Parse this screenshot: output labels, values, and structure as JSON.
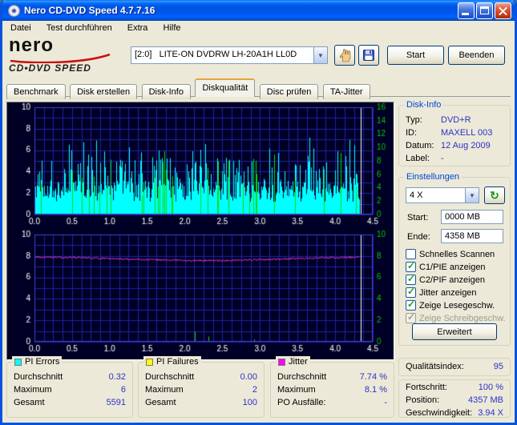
{
  "window": {
    "title": "Nero CD-DVD Speed 4.7.7.16"
  },
  "menu": {
    "items": [
      {
        "label": "Datei"
      },
      {
        "label": "Test durchführen"
      },
      {
        "label": "Extra"
      },
      {
        "label": "Hilfe"
      }
    ]
  },
  "logo": {
    "brand": "nero",
    "product": "CD•DVD SPEED"
  },
  "toolbar": {
    "drive_combo_value": "[2:0]   LITE-ON DVDRW LH-20A1H LL0D",
    "start_label": "Start",
    "quit_label": "Beenden"
  },
  "tabs": {
    "items": [
      {
        "label": "Benchmark"
      },
      {
        "label": "Disk erstellen"
      },
      {
        "label": "Disk-Info"
      },
      {
        "label": "Diskqualität"
      },
      {
        "label": "Disc prüfen"
      },
      {
        "label": "TA-Jitter"
      }
    ]
  },
  "disk_info": {
    "title": "Disk-Info",
    "rows": [
      {
        "label": "Typ:",
        "value": "DVD+R"
      },
      {
        "label": "ID:",
        "value": "MAXELL 003"
      },
      {
        "label": "Datum:",
        "value": "12 Aug 2009"
      },
      {
        "label": "Label:",
        "value": "-"
      }
    ]
  },
  "settings": {
    "title": "Einstellungen",
    "speed_combo_value": "4 X",
    "start_label": "Start:",
    "start_value": "0000 MB",
    "end_label": "Ende:",
    "end_value": "4358 MB",
    "checkboxes": [
      {
        "label": "Schnelles Scannen",
        "checked": false
      },
      {
        "label": "C1/PIE anzeigen",
        "checked": true
      },
      {
        "label": "C2/PIF anzeigen",
        "checked": true
      },
      {
        "label": "Jitter anzeigen",
        "checked": true
      },
      {
        "label": "Zeige Lesegeschw.",
        "checked": true
      },
      {
        "label": "Zeige Schreibgeschw.",
        "checked": true,
        "disabled": true
      }
    ],
    "advanced_label": "Erweitert"
  },
  "quality": {
    "label": "Qualitätsindex:",
    "value": "95"
  },
  "progress": {
    "rows": [
      {
        "label": "Fortschritt:",
        "value": "100 %"
      },
      {
        "label": "Position:",
        "value": "4357 MB"
      },
      {
        "label": "Geschwindigkeit:",
        "value": "3.94 X"
      }
    ]
  },
  "stats": {
    "pi_errors": {
      "title": "PI Errors",
      "color": "#00FFFF",
      "rows": [
        {
          "label": "Durchschnitt",
          "value": "0.32"
        },
        {
          "label": "Maximum",
          "value": "6"
        },
        {
          "label": "Gesamt",
          "value": "5591"
        }
      ]
    },
    "pi_failures": {
      "title": "PI Failures",
      "color": "#FFFF00",
      "rows": [
        {
          "label": "Durchschnitt",
          "value": "0.00"
        },
        {
          "label": "Maximum",
          "value": "2"
        },
        {
          "label": "Gesamt",
          "value": "100"
        }
      ]
    },
    "jitter": {
      "title": "Jitter",
      "color": "#FF00FF",
      "rows": [
        {
          "label": "Durchschnitt",
          "value": "7.74 %"
        },
        {
          "label": "Maximum",
          "value": "8.1 %"
        },
        {
          "label": "PO Ausfälle:",
          "value": "-"
        }
      ]
    }
  },
  "chart_data": {
    "type": "line",
    "x_range": [
      0,
      4.5
    ],
    "x_ticks": [
      "0.0",
      "0.5",
      "1.0",
      "1.5",
      "2.0",
      "2.5",
      "3.0",
      "3.5",
      "4.0",
      "4.5"
    ],
    "end_position_x": 4.34,
    "colors": {
      "background": "#000026",
      "grid": "#2121A6",
      "border": "#4242C8",
      "axis_left": "#FFFFFF",
      "axis_right": "#00C800",
      "pie": "#00FFFF",
      "pif_spikes": "#00E000",
      "jitter": "#FF40D0",
      "end_marker": "#FFFFFF"
    },
    "top_chart": {
      "series_name": "C1/PIE errors",
      "y_left_ticks": [
        0,
        2,
        4,
        6,
        8,
        10
      ],
      "y_right_ticks": [
        0,
        2,
        4,
        6,
        8,
        10,
        12,
        14,
        16
      ],
      "pie_average": 0.32,
      "pie_maximum": 6,
      "pie_total": 5591
    },
    "bottom_chart": {
      "series_name": "Jitter %",
      "y_left_ticks": [
        0,
        2,
        4,
        6,
        8,
        10
      ],
      "y_right_ticks": [
        0,
        2,
        4,
        6,
        8,
        10
      ],
      "jitter_average_percent": 7.74,
      "jitter_maximum_percent": 8.1
    },
    "generator": {
      "seed": 20090812,
      "pie_base": 1.2,
      "pie_noise": 2.0,
      "spike_prob": 0.3,
      "spike_height": 3.4,
      "big_spike_prob": 0.06,
      "big_spike_height": 4.5,
      "green_prob": 0.08,
      "green_min": 1.5,
      "green_range": 5.0,
      "jitter_base": 7.73,
      "jitter_wave_amp": 0.15,
      "jitter_wave_freq": 1.4,
      "jitter_noise": 0.15,
      "bottom_green_prob": 0.018,
      "bottom_green_min": 0.2,
      "bottom_green_range": 1.0
    }
  }
}
